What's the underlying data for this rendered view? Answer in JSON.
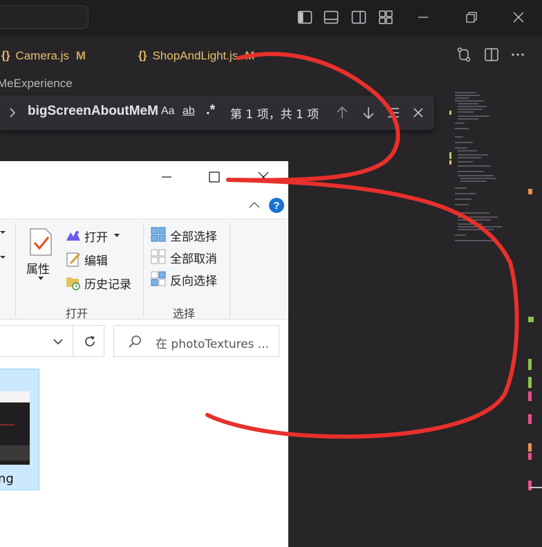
{
  "editor": {
    "tabs": [
      {
        "icon": "{}",
        "label": "Camera.js",
        "status": "M"
      },
      {
        "icon": "{}",
        "label": "ShopAndLight.js",
        "status": "M"
      }
    ],
    "breadcrumb": "MeExperience",
    "find": {
      "query": "bigScreenAboutMeMe",
      "options": [
        "Aa",
        "ab",
        ".*"
      ],
      "match_count": "第 1 项，共 1 项"
    },
    "colors": {
      "accent_js": "#e8c06a",
      "annotation": "#e8302c"
    }
  },
  "explorer": {
    "ribbon": {
      "properties_label": "属性",
      "open_label": "打开",
      "edit_label": "编辑",
      "history_label": "历史记录",
      "group_open": "打开",
      "select_all": "全部选择",
      "select_none": "全部取消",
      "invert_selection": "反向选择",
      "group_select": "选择"
    },
    "search_placeholder": "在 photoTextures ...",
    "file": {
      "label": "ng"
    }
  }
}
